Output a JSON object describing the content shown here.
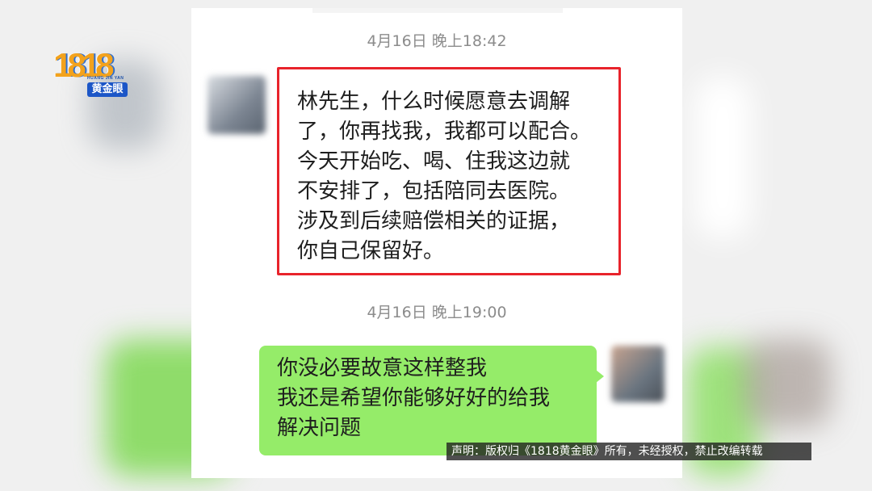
{
  "logo": {
    "number": "1818",
    "subtitle_en": "HUANG JIN YAN",
    "subtitle": "黄金眼"
  },
  "chat": {
    "timestamp_1": "4月16日 晚上18:42",
    "message_in": "林先生，什么时候愿意去调解\n了，你再找我，我都可以配合。\n今天开始吃、喝、住我这边就\n不安排了，包括陪同去医院。\n涉及到后续赔偿相关的证据，\n你自己保留好。",
    "timestamp_2": "4月16日 晚上19:00",
    "message_out": "你没必要故意这样整我\n我还是希望你能够好好的给我\n解决问题"
  },
  "disclaimer": "声明：版权归《1818黄金眼》所有，未经授权，禁止改编转载",
  "colors": {
    "highlight_border": "#e8232b",
    "outgoing_bubble": "#95ec69",
    "logo_orange": "#f3a21c",
    "logo_blue": "#1c56c7"
  }
}
